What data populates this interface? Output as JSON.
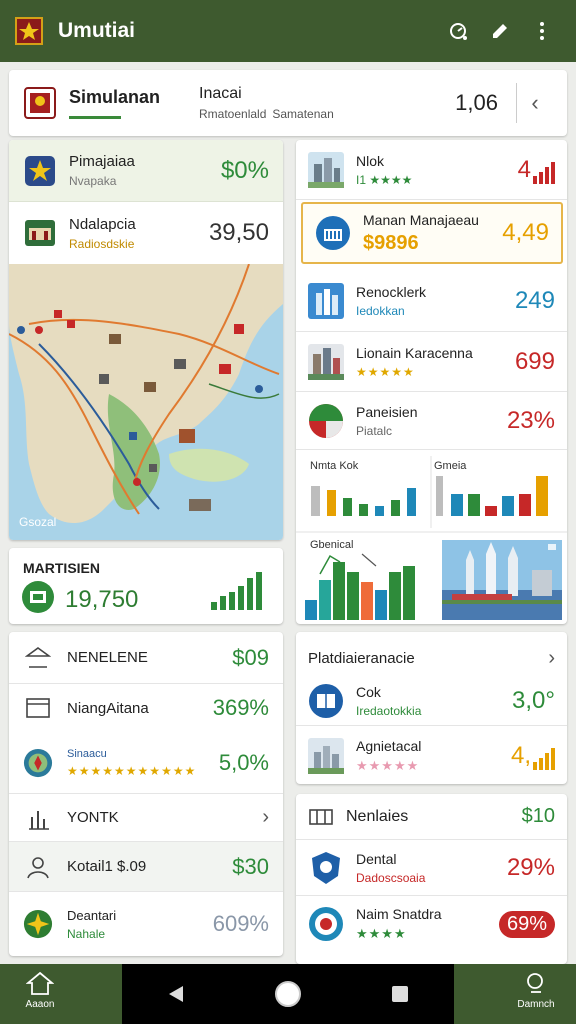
{
  "app": {
    "title": "Umutiai"
  },
  "header": {
    "name": "Simulanan",
    "col2_title": "Inacai",
    "col2_sub": "Rmatoenlald",
    "col3_sub": "Samatenan",
    "number": "1,06"
  },
  "left_top": [
    {
      "name": "Pimajaiaa",
      "sub": "Nvapaka",
      "value": "$0%",
      "color": "#2e8b3a"
    },
    {
      "name": "Ndalapcia",
      "sub": "Radiosdskie",
      "value": "39,50",
      "color": "#333333"
    }
  ],
  "map": {
    "credit": "Gsozal"
  },
  "mart": {
    "label": "MARTISIEN",
    "value": "19,750"
  },
  "left_list": [
    {
      "name": "NENELENE",
      "sub": "",
      "value": "$09",
      "color": "#2e8b3a"
    },
    {
      "name": "NiangAitana",
      "sub": "",
      "value": "369%",
      "color": "#2e8b3a"
    },
    {
      "name": "Sinaacu",
      "sub": "★★★★★★★★★★★",
      "value": "5,0%",
      "color": "#2e8b3a"
    }
  ],
  "left_list2": [
    {
      "name": "YONTK",
      "value": ""
    },
    {
      "name": "Kotail1 $.09",
      "value": "$30",
      "color": "#2e8b3a"
    },
    {
      "name": "Deantari",
      "sub": "Nahale",
      "value": "609%",
      "color": "#8a97a8"
    }
  ],
  "right_top": [
    {
      "name": "Nlok",
      "sub": "I1 ★★★★",
      "value": "4",
      "color": "#c62828"
    },
    {
      "name": "Manan Manajaeau",
      "sub": "$9896",
      "value": "4,49",
      "color": "#e6a000"
    },
    {
      "name": "Renocklerk",
      "sub": "Iedokkan",
      "value": "249",
      "color": "#1e88b8"
    },
    {
      "name": "Lionain Karacenna",
      "sub": "★★★★★",
      "value": "699",
      "color": "#c62828"
    },
    {
      "name": "Paneisien",
      "sub": "Piatalc",
      "value": "23%",
      "color": "#c62828"
    }
  ],
  "mini_charts": {
    "a_title": "Nmta Kok",
    "b_title": "Gmeia",
    "c_title": "Gbenical"
  },
  "right_list": {
    "header": "Platdiaieranacie",
    "rows": [
      {
        "name": "Cok",
        "sub": "Iredaotokkia",
        "value": "3,0°",
        "color": "#2e8b3a"
      },
      {
        "name": "Agnietacal",
        "sub": "★★★★★",
        "value": "4,",
        "color": "#e6a000"
      }
    ]
  },
  "right_list2": {
    "header": "Nenlaies",
    "header_value": "$10",
    "rows": [
      {
        "name": "Dental",
        "sub": "Dadoscsoaia",
        "value": "29%",
        "color": "#c62828"
      },
      {
        "name": "Naim Snatdra",
        "sub": "★★★★",
        "value": "69%",
        "color": "#ffffff"
      }
    ]
  },
  "bottom": {
    "left": "Aaaon",
    "right": "Damnch"
  },
  "colors": {
    "appbar": "#3e5a2f",
    "green": "#2e8b3a",
    "red": "#c62828",
    "amber": "#e6a000",
    "blue": "#1e88b8"
  }
}
